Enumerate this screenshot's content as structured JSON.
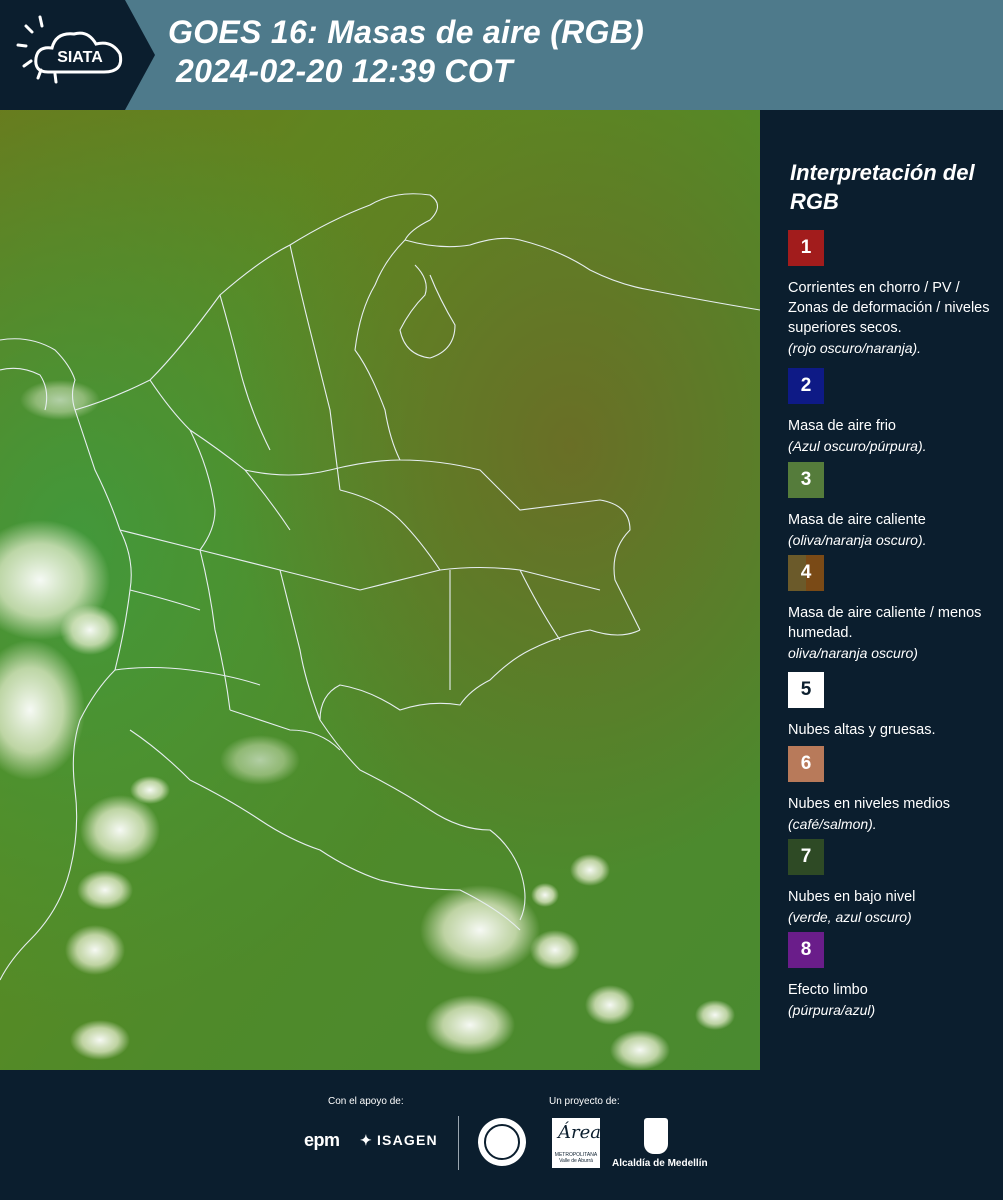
{
  "header": {
    "logo_text": "SIATA",
    "title_line1": "GOES 16: Masas de aire (RGB)",
    "title_line2": "2024-02-20 12:39 COT"
  },
  "legend": {
    "title": "Interpretación del RGB",
    "items": [
      {
        "number": "1",
        "color": "#a21c1c",
        "text": "Corrientes en chorro / PV / Zonas de deformación / niveles superiores secos.",
        "sub": "(rojo oscuro/naranja)."
      },
      {
        "number": "2",
        "color": "#0e1a86",
        "text": "Masa de aire frio",
        "sub": "(Azul oscuro/púrpura)."
      },
      {
        "number": "3",
        "color": "#557c3b",
        "text": "Masa de aire caliente",
        "sub": "(oliva/naranja oscuro)."
      },
      {
        "number": "4",
        "color": "#6b5a2a",
        "color2": "#7a4a16",
        "text": "Masa de aire caliente / menos humedad.",
        "sub": "oliva/naranja oscuro)"
      },
      {
        "number": "5",
        "color": "#ffffff",
        "text": "Nubes altas y gruesas.",
        "sub": ""
      },
      {
        "number": "6",
        "color": "#b87a5a",
        "text": "Nubes en niveles medios",
        "sub": "(café/salmon)."
      },
      {
        "number": "7",
        "color": "#2e4a25",
        "text": "Nubes en bajo nivel",
        "sub": "(verde, azul oscuro)"
      },
      {
        "number": "8",
        "color": "#6a1d8a",
        "text": "Efecto limbo",
        "sub": "(púrpura/azul)"
      }
    ]
  },
  "footer": {
    "support_label": "Con el apoyo de:",
    "project_label": "Un proyecto de:",
    "epm": "epm",
    "isagen": "ISAGEN",
    "area_script": "Área",
    "area_small": "METROPOLITANA Valle de Aburrá",
    "alcaldia": "Alcaldía de Medellín"
  }
}
